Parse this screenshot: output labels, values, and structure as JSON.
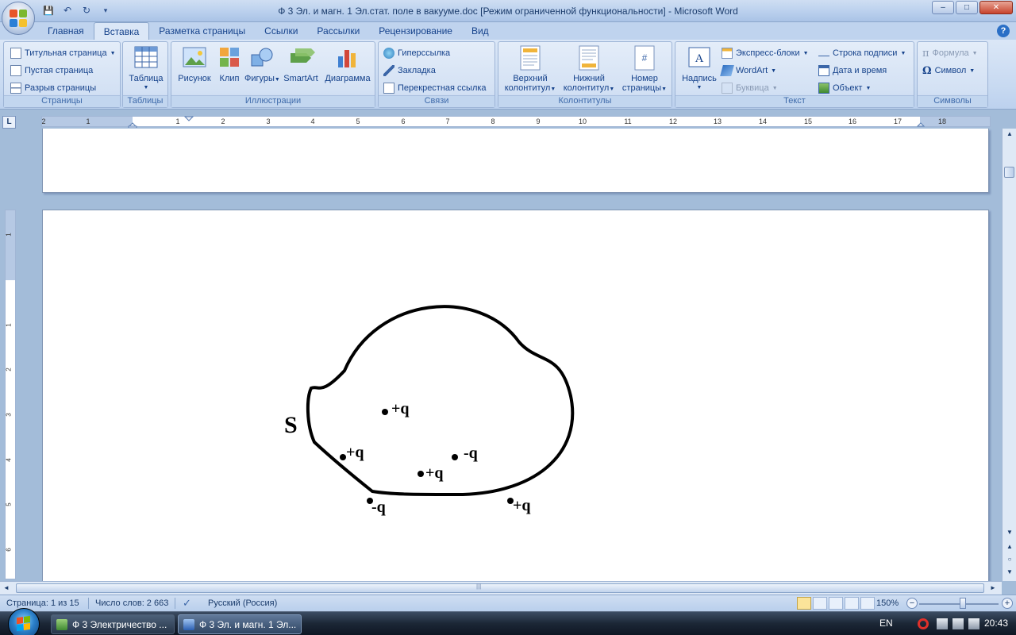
{
  "window": {
    "title": "Ф 3 Эл. и магн. 1 Эл.стат. поле в вакууме.doc [Режим ограниченной функциональности] - Microsoft Word",
    "minimize": "–",
    "maximize": "□",
    "close": "✕"
  },
  "qat": {
    "save": "💾",
    "undo": "↶",
    "redo": "↻",
    "customize": "▾"
  },
  "tabs": [
    "Главная",
    "Вставка",
    "Разметка страницы",
    "Ссылки",
    "Рассылки",
    "Рецензирование",
    "Вид"
  ],
  "help": "?",
  "ribbon": {
    "pages": {
      "label": "Страницы",
      "cover": "Титульная страница",
      "blank": "Пустая страница",
      "break": "Разрыв страницы"
    },
    "tables": {
      "label": "Таблицы",
      "table": "Таблица"
    },
    "illustrations": {
      "label": "Иллюстрации",
      "picture": "Рисунок",
      "clip": "Клип",
      "shapes": "Фигуры",
      "smartart": "SmartArt",
      "chart": "Диаграмма"
    },
    "links": {
      "label": "Связи",
      "hyperlink": "Гиперссылка",
      "bookmark": "Закладка",
      "crossref": "Перекрестная ссылка"
    },
    "headers": {
      "label": "Колонтитулы",
      "header_l1": "Верхний",
      "header_l2": "колонтитул",
      "footer_l1": "Нижний",
      "footer_l2": "колонтитул",
      "pagenum_l1": "Номер",
      "pagenum_l2": "страницы"
    },
    "text": {
      "label": "Текст",
      "textbox": "Надпись",
      "quickparts": "Экспресс-блоки",
      "wordart": "WordArt",
      "dropcap": "Буквица",
      "signature": "Строка подписи",
      "datetime": "Дата и время",
      "object": "Объект"
    },
    "symbols": {
      "label": "Символы",
      "equation": "Формула",
      "symbol": "Символ"
    }
  },
  "ruler": {
    "corner": "L",
    "h_numbers": [
      "2",
      "1",
      "1",
      "2",
      "3",
      "4",
      "5",
      "6",
      "7",
      "8",
      "9",
      "10",
      "11",
      "12",
      "13",
      "14",
      "15",
      "16",
      "17",
      "18"
    ],
    "v_numbers": [
      "1",
      "1",
      "2",
      "3",
      "4",
      "5",
      "6"
    ]
  },
  "figure": {
    "surface_label": "S",
    "charges": [
      "+q",
      "+q",
      "-q",
      "-q",
      "+q",
      "+q"
    ]
  },
  "status": {
    "page": "Страница: 1 из 15",
    "words": "Число слов: 2 663",
    "language": "Русский (Россия)",
    "zoom": "150%",
    "zoom_minus": "−",
    "zoom_plus": "+"
  },
  "taskbar": {
    "items": [
      "Ф 3 Электричество ...",
      "Ф 3 Эл. и магн. 1 Эл..."
    ],
    "lang": "EN",
    "clock": "20:43"
  },
  "colors": {
    "accent": "#15428b",
    "ribbon": "#dbe7f7",
    "doc_bg": "#a3bcd9",
    "taskbar": "#1c2736"
  }
}
